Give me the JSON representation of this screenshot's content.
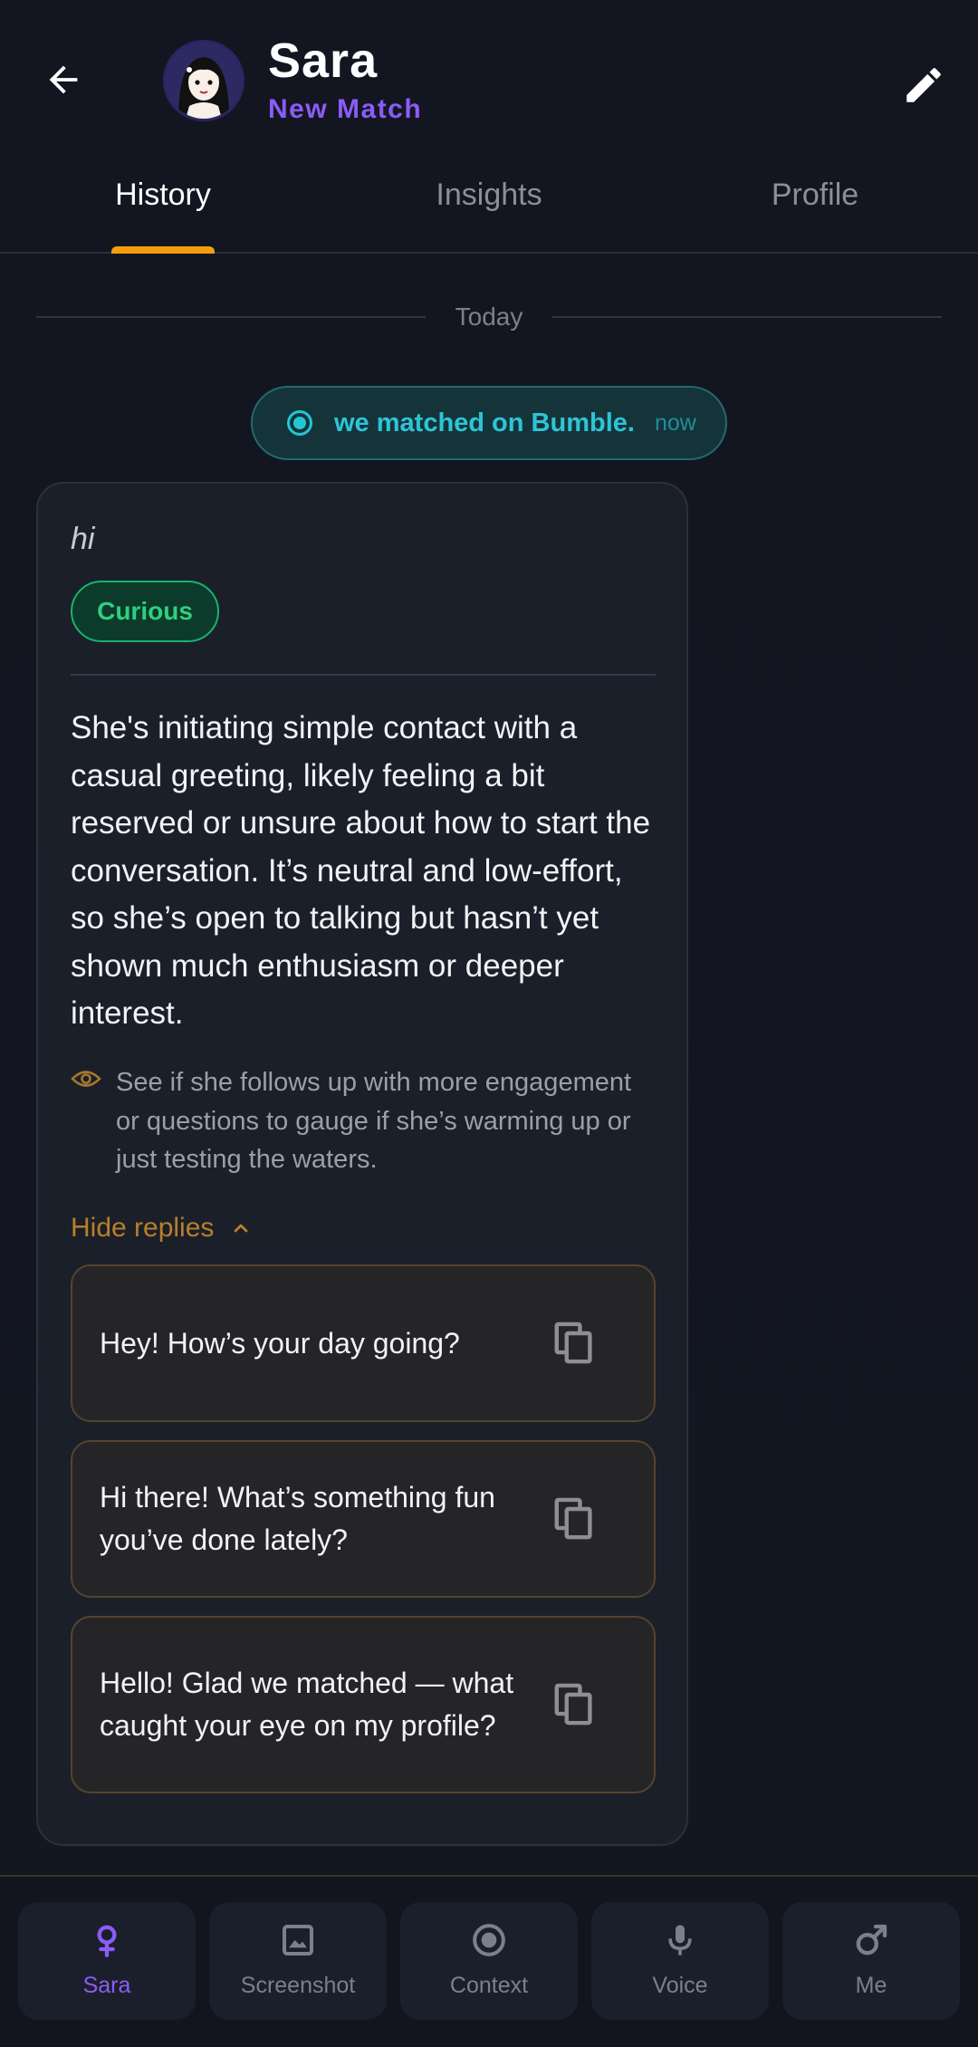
{
  "header": {
    "name": "Sara",
    "subtitle": "New Match",
    "back_icon": "arrow-left-icon",
    "edit_icon": "pencil-icon"
  },
  "tabs": [
    {
      "label": "History",
      "active": true
    },
    {
      "label": "Insights",
      "active": false
    },
    {
      "label": "Profile",
      "active": false
    }
  ],
  "timeline": {
    "date_label": "Today",
    "match_event": {
      "text": "we matched on Bumble.",
      "time": "now",
      "icon": "radio-dot-icon"
    }
  },
  "message_card": {
    "message": "hi",
    "mood_tag": "Curious",
    "analysis": "She's initiating simple contact with a casual greeting, likely feeling a bit reserved or unsure about how to start the conversation. It’s neutral and low-effort, so she’s open to talking but hasn’t yet shown much enthusiasm or deeper interest.",
    "tip": "See if she follows up with more engagement or questions to gauge if she’s warming up or just testing the waters.",
    "toggle_label": "Hide replies",
    "replies": [
      {
        "text": "Hey! How’s your day going?"
      },
      {
        "text": "Hi there! What’s something fun you’ve done lately?"
      },
      {
        "text": "Hello! Glad we matched — what caught your eye on my profile?"
      }
    ]
  },
  "bottom_nav": [
    {
      "label": "Sara",
      "icon": "female-symbol-icon",
      "active": true
    },
    {
      "label": "Screenshot",
      "icon": "image-icon",
      "active": false
    },
    {
      "label": "Context",
      "icon": "target-icon",
      "active": false
    },
    {
      "label": "Voice",
      "icon": "microphone-icon",
      "active": false
    },
    {
      "label": "Me",
      "icon": "male-symbol-icon",
      "active": false
    }
  ],
  "colors": {
    "background": "#131722",
    "accent_purple": "#8b5cf6",
    "accent_orange": "#f59e0b",
    "teal": "#2ec4d6",
    "green": "#2fd07f"
  }
}
